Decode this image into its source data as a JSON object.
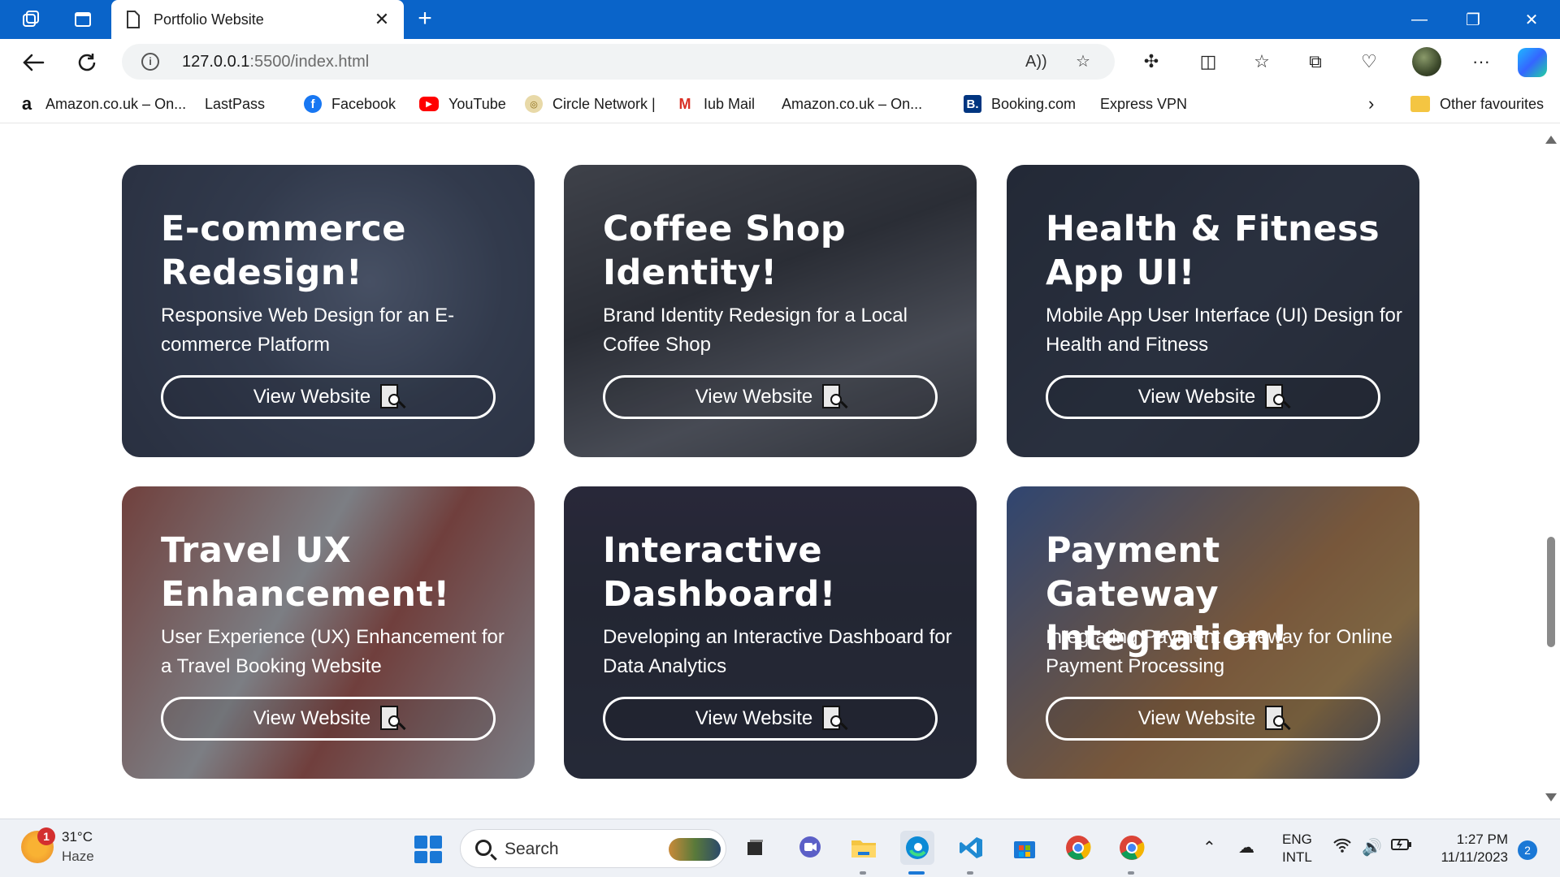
{
  "browser": {
    "tab_title": "Portfolio Website",
    "url_host": "127.0.0.1",
    "url_path": ":5500/index.html",
    "favourites": [
      {
        "label": "Amazon.co.uk – On...",
        "icon": "amazon-icon"
      },
      {
        "label": "LastPass",
        "icon": "page-icon"
      },
      {
        "label": "Facebook",
        "icon": "facebook-icon"
      },
      {
        "label": "YouTube",
        "icon": "youtube-icon"
      },
      {
        "label": "Circle Network |",
        "icon": "circle-network-icon"
      },
      {
        "label": "Iub Mail",
        "icon": "gmail-icon"
      },
      {
        "label": "Amazon.co.uk – On...",
        "icon": "page-icon"
      },
      {
        "label": "Booking.com",
        "icon": "booking-icon"
      },
      {
        "label": "Express VPN",
        "icon": "page-icon"
      }
    ],
    "other_favourites": "Other favourites"
  },
  "portfolio": {
    "cards": [
      {
        "title": "E-commerce Redesign!",
        "description": "Responsive Web Design for an E-commerce Platform",
        "button": "View Website"
      },
      {
        "title": "Coffee Shop Identity!",
        "description": "Brand Identity Redesign for a Local Coffee Shop",
        "button": "View Website"
      },
      {
        "title": "Health & Fitness App UI!",
        "description": "Mobile App User Interface (UI) Design for Health and Fitness",
        "button": "View Website"
      },
      {
        "title": "Travel UX Enhancement!",
        "description": "User Experience (UX) Enhancement for a Travel Booking Website",
        "button": "View Website"
      },
      {
        "title": "Interactive Dashboard!",
        "description": "Developing an Interactive Dashboard for Data Analytics",
        "button": "View Website"
      },
      {
        "title": "Payment Gateway Integration!",
        "description": "Integrating Payment Gateway for Online Payment Processing",
        "button": "View Website"
      }
    ]
  },
  "taskbar": {
    "weather_badge": "1",
    "temperature": "31°C",
    "condition": "Haze",
    "search_placeholder": "Search",
    "language_line1": "ENG",
    "language_line2": "INTL",
    "time": "1:27 PM",
    "date": "11/11/2023",
    "notifications": "2"
  },
  "colors": {
    "titlebar": "#0a64c9",
    "accent": "#1a78d6"
  }
}
